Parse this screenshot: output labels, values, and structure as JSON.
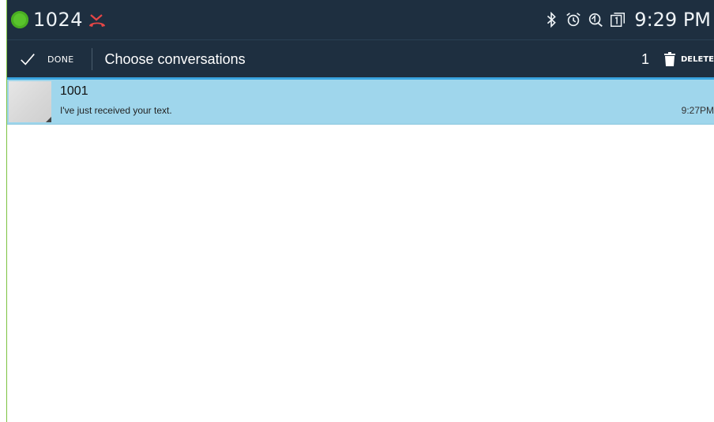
{
  "status_bar": {
    "call_number": "1024",
    "time": "9:29 PM",
    "icons": [
      "phone-active-icon",
      "missed-call-icon",
      "bluetooth-icon",
      "alarm-icon",
      "sync-icon",
      "calendar-icon"
    ],
    "colors": {
      "background": "#1e2f40",
      "active_dot": "#59c32c",
      "missed_call": "#e64646"
    }
  },
  "action_bar": {
    "done_label": "DONE",
    "title": "Choose conversations",
    "selected_count": "1",
    "delete_label": "DELETE"
  },
  "conversations": [
    {
      "name": "1001",
      "snippet": "I've just received your text.",
      "time": "9:27PM",
      "selected": true
    }
  ],
  "colors": {
    "selection": "#9fd6ec",
    "accent": "#3aa5e0"
  }
}
